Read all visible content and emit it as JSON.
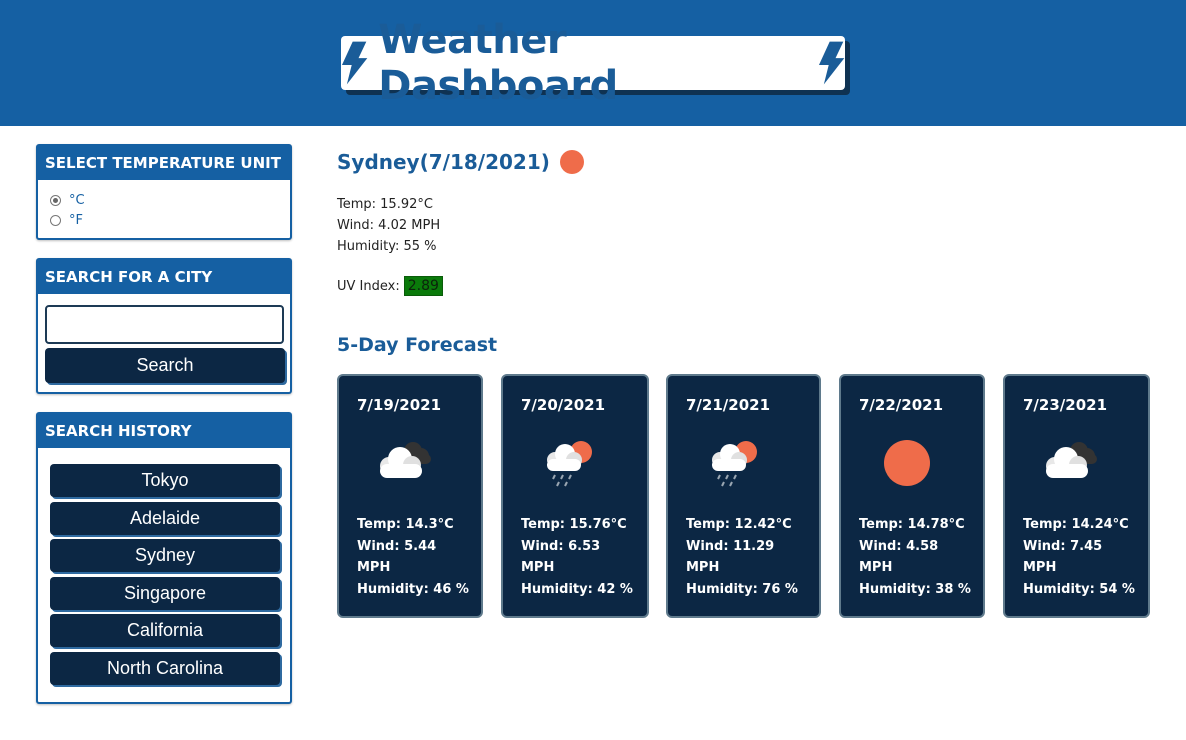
{
  "header": {
    "title": "Weather Dashboard",
    "left_icon": "lightning-bolt-icon",
    "right_icon": "lightning-bolt-icon",
    "bg_color": "#1560a3",
    "title_color": "#1a5c98"
  },
  "unit_panel": {
    "heading": "SELECT TEMPERATURE UNIT",
    "options": [
      {
        "label": "°C",
        "checked": true
      },
      {
        "label": "°F",
        "checked": false
      }
    ]
  },
  "search_panel": {
    "heading": "SEARCH FOR A CITY",
    "input_value": "",
    "button_label": "Search"
  },
  "history_panel": {
    "heading": "SEARCH HISTORY",
    "items": [
      "Tokyo",
      "Adelaide",
      "Sydney",
      "Singapore",
      "California",
      "North Carolina"
    ]
  },
  "current": {
    "title": "Sydney(7/18/2021)",
    "icon": "sun-icon",
    "temp": "Temp: 15.92°C",
    "wind": "Wind: 4.02 MPH",
    "humidity": "Humidity: 55 %",
    "uv_label": "UV Index:",
    "uv_value": "2.89",
    "uv_color": "#0a7a0a"
  },
  "forecast": {
    "heading": "5-Day Forecast",
    "days": [
      {
        "date": "7/19/2021",
        "icon": "cloudy-icon",
        "temp": "Temp: 14.3°C",
        "wind_line1": "Wind: 5.44",
        "wind_line2": "MPH",
        "humidity": "Humidity: 46 %"
      },
      {
        "date": "7/20/2021",
        "icon": "rain-sun-icon",
        "temp": "Temp: 15.76°C",
        "wind_line1": "Wind: 6.53",
        "wind_line2": "MPH",
        "humidity": "Humidity: 42 %"
      },
      {
        "date": "7/21/2021",
        "icon": "rain-sun-icon",
        "temp": "Temp: 12.42°C",
        "wind_line1": "Wind: 11.29",
        "wind_line2": "MPH",
        "humidity": "Humidity: 76 %"
      },
      {
        "date": "7/22/2021",
        "icon": "sun-icon",
        "temp": "Temp: 14.78°C",
        "wind_line1": "Wind: 4.58",
        "wind_line2": "MPH",
        "humidity": "Humidity: 38 %"
      },
      {
        "date": "7/23/2021",
        "icon": "cloudy-icon",
        "temp": "Temp: 14.24°C",
        "wind_line1": "Wind: 7.45",
        "wind_line2": "MPH",
        "humidity": "Humidity: 54 %"
      }
    ]
  }
}
